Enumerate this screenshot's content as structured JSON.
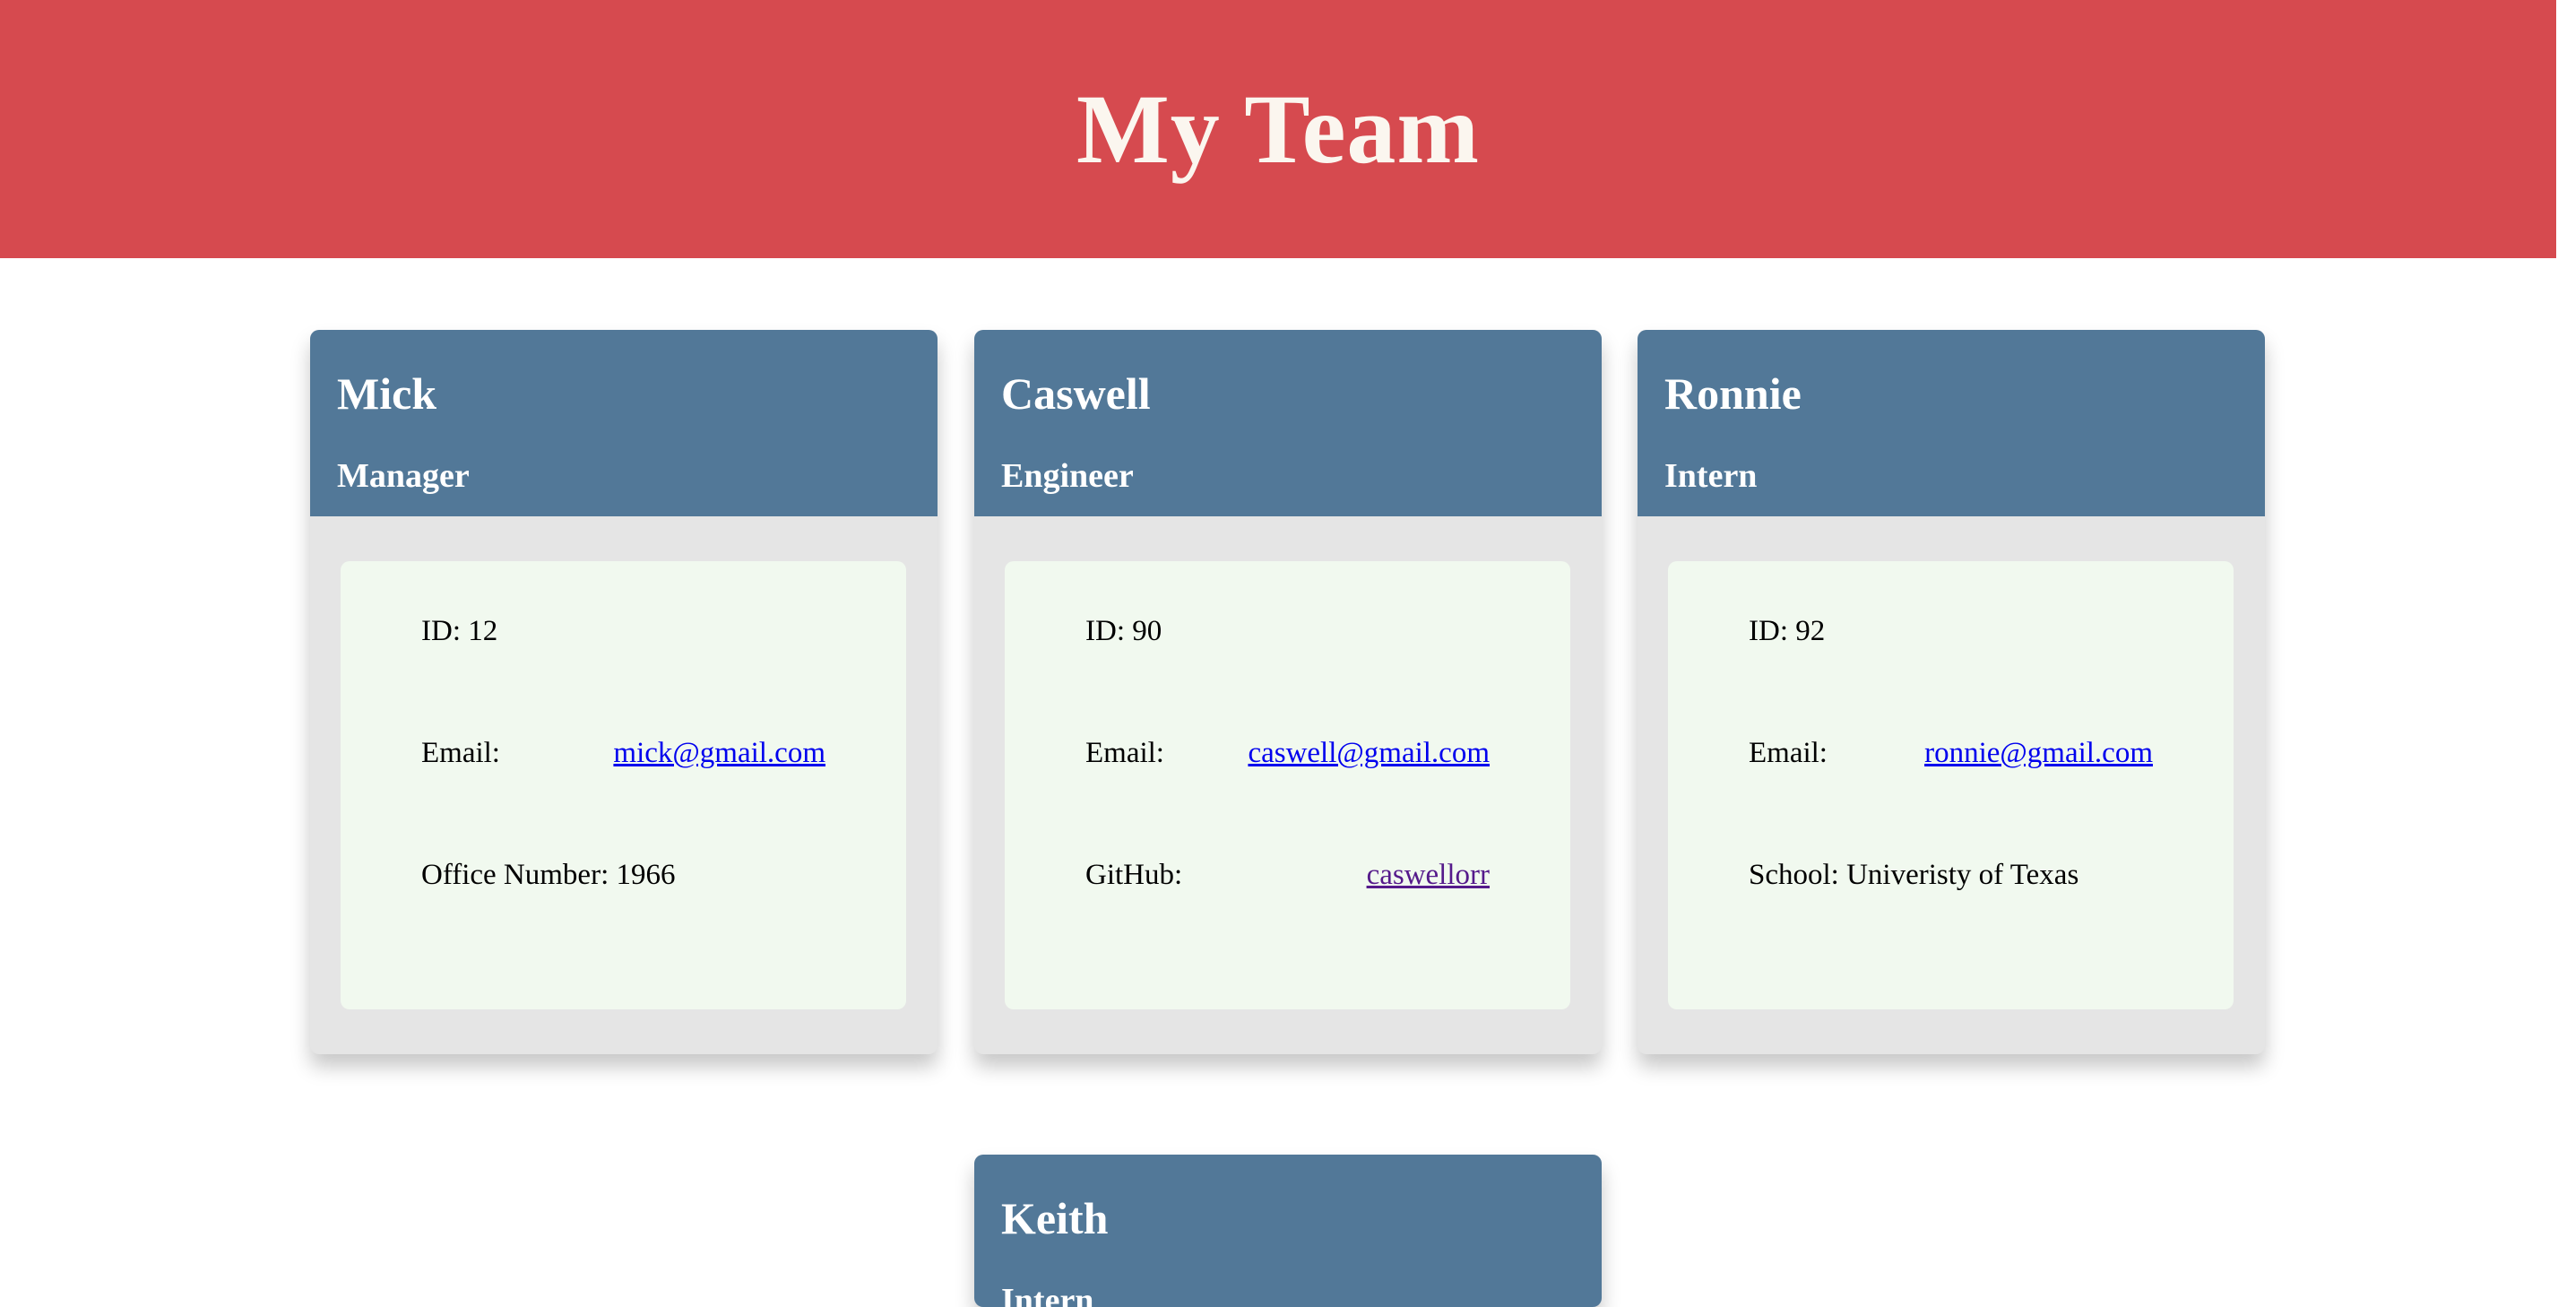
{
  "header": {
    "title": "My Team"
  },
  "team": [
    {
      "name": "Mick",
      "role": "Manager",
      "id_label": "ID: 12",
      "email_label": "Email:",
      "email": "mick@gmail.com",
      "extra_text": "Office Number: 1966"
    },
    {
      "name": "Caswell",
      "role": "Engineer",
      "id_label": "ID: 90",
      "email_label": "Email:",
      "email": "caswell@gmail.com",
      "github_label": "GitHub:",
      "github": "caswellorr"
    },
    {
      "name": "Ronnie",
      "role": "Intern",
      "id_label": "ID: 92",
      "email_label": "Email:",
      "email": "ronnie@gmail.com",
      "extra_text": "School: Univeristy of Texas"
    },
    {
      "name": "Keith",
      "role": "Intern"
    }
  ],
  "colors": {
    "header_bg": "#d64a4f",
    "card_head_bg": "#527898",
    "card_body_bg": "#e5e5e5",
    "info_bg": "#f1f9ef",
    "link": "#0000ee",
    "visited_link": "#551a8b"
  }
}
